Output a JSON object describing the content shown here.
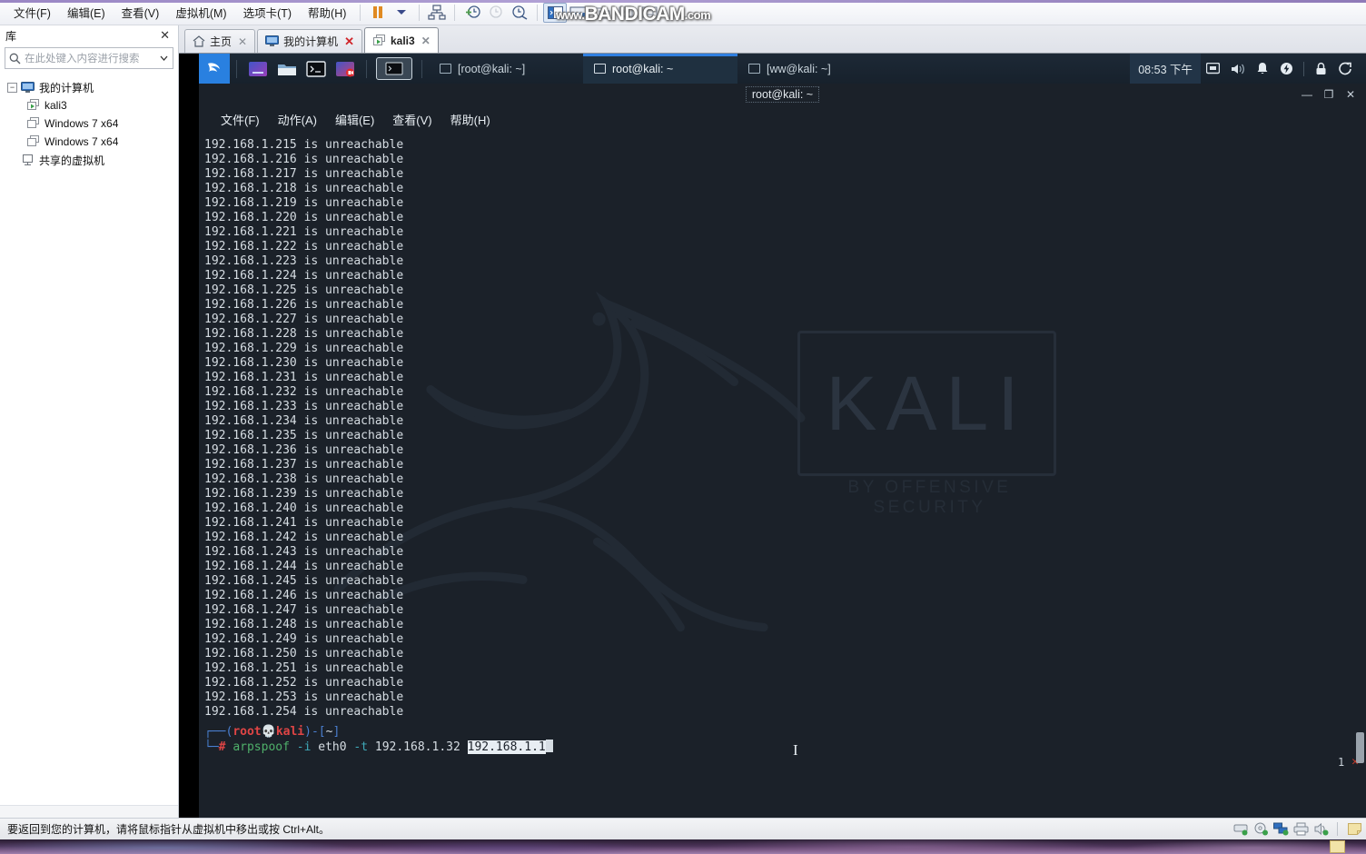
{
  "app": {
    "menu": [
      "文件(F)",
      "编辑(E)",
      "查看(V)",
      "虚拟机(M)",
      "选项卡(T)",
      "帮助(H)"
    ],
    "watermark": {
      "prefix": "www.",
      "brand": "BANDICAM",
      "suffix": ".com"
    }
  },
  "sidebar": {
    "title": "库",
    "close_label": "✕",
    "search_placeholder": "在此处键入内容进行搜索",
    "tree": [
      {
        "label": "我的计算机",
        "icon": "monitor-icon",
        "level": 0,
        "expander": "−"
      },
      {
        "label": "kali3",
        "icon": "vm-running-icon",
        "level": 1,
        "expander": ""
      },
      {
        "label": "Windows 7 x64",
        "icon": "vm-icon",
        "level": 1,
        "expander": ""
      },
      {
        "label": "Windows 7 x64",
        "icon": "vm-icon",
        "level": 1,
        "expander": ""
      },
      {
        "label": "共享的虚拟机",
        "icon": "shared-vm-icon",
        "level": 0,
        "expander": ""
      }
    ]
  },
  "tabs": [
    {
      "label": "主页",
      "icon": "home-icon",
      "active": false,
      "close": "✕",
      "close_red": false
    },
    {
      "label": "我的计算机",
      "icon": "monitor-icon",
      "active": false,
      "close": "✕",
      "close_red": true
    },
    {
      "label": "kali3",
      "icon": "vm-running-icon",
      "active": true,
      "close": "✕",
      "close_red": false
    }
  ],
  "kali_panel": {
    "launchers": [
      "kali-menu-icon",
      "files-blue-icon",
      "folder-icon",
      "terminal-icon",
      "screen-record-icon",
      "terminal-window-icon"
    ],
    "tasks": [
      {
        "label": "[root@kali: ~]",
        "active": false
      },
      {
        "label": "root@kali: ~",
        "active": true
      },
      {
        "label": "[ww@kali: ~]",
        "active": false
      }
    ],
    "clock": "08:53 下午",
    "tray_icons": [
      "display-icon",
      "volume-icon",
      "notification-bell-icon",
      "power-update-icon",
      "lock-icon",
      "logout-icon"
    ]
  },
  "terminal": {
    "title": "root@kali: ~",
    "window_buttons": {
      "minimize": "—",
      "maximize": "❐",
      "close": "✕"
    },
    "menu": [
      "文件(F)",
      "动作(A)",
      "编辑(E)",
      "查看(V)",
      "帮助(H)"
    ],
    "background_logo": {
      "text": "KALI",
      "subtitle": "BY OFFENSIVE SECURITY"
    },
    "output_lines": [
      "192.168.1.215 is unreachable",
      "192.168.1.216 is unreachable",
      "192.168.1.217 is unreachable",
      "192.168.1.218 is unreachable",
      "192.168.1.219 is unreachable",
      "192.168.1.220 is unreachable",
      "192.168.1.221 is unreachable",
      "192.168.1.222 is unreachable",
      "192.168.1.223 is unreachable",
      "192.168.1.224 is unreachable",
      "192.168.1.225 is unreachable",
      "192.168.1.226 is unreachable",
      "192.168.1.227 is unreachable",
      "192.168.1.228 is unreachable",
      "192.168.1.229 is unreachable",
      "192.168.1.230 is unreachable",
      "192.168.1.231 is unreachable",
      "192.168.1.232 is unreachable",
      "192.168.1.233 is unreachable",
      "192.168.1.234 is unreachable",
      "192.168.1.235 is unreachable",
      "192.168.1.236 is unreachable",
      "192.168.1.237 is unreachable",
      "192.168.1.238 is unreachable",
      "192.168.1.239 is unreachable",
      "192.168.1.240 is unreachable",
      "192.168.1.241 is unreachable",
      "192.168.1.242 is unreachable",
      "192.168.1.243 is unreachable",
      "192.168.1.244 is unreachable",
      "192.168.1.245 is unreachable",
      "192.168.1.246 is unreachable",
      "192.168.1.247 is unreachable",
      "192.168.1.248 is unreachable",
      "192.168.1.249 is unreachable",
      "192.168.1.250 is unreachable",
      "192.168.1.251 is unreachable",
      "192.168.1.252 is unreachable",
      "192.168.1.253 is unreachable",
      "192.168.1.254 is unreachable"
    ],
    "prompt": {
      "line1_corner": "┌──(",
      "line1_user": "root",
      "line1_skull": "💀",
      "line1_host": "kali",
      "line1_close": ")-[",
      "line1_path": "~",
      "line1_end": "]",
      "line2_corner": "└─",
      "line2_hash": "#",
      "command_name": "arpspoof",
      "flag_i": "-i",
      "iface": "eth0",
      "flag_t": "-t",
      "target": "192.168.1.32",
      "selected_arg": "192.168.1.1"
    },
    "tab_count": "1",
    "tab_close": "✕"
  },
  "statusbar": {
    "message": "要返回到您的计算机，请将鼠标指针从虚拟机中移出或按 Ctrl+Alt。",
    "devices": [
      "harddisk-icon",
      "cdrom-icon",
      "network-icon",
      "printer-icon",
      "sound-icon"
    ]
  }
}
